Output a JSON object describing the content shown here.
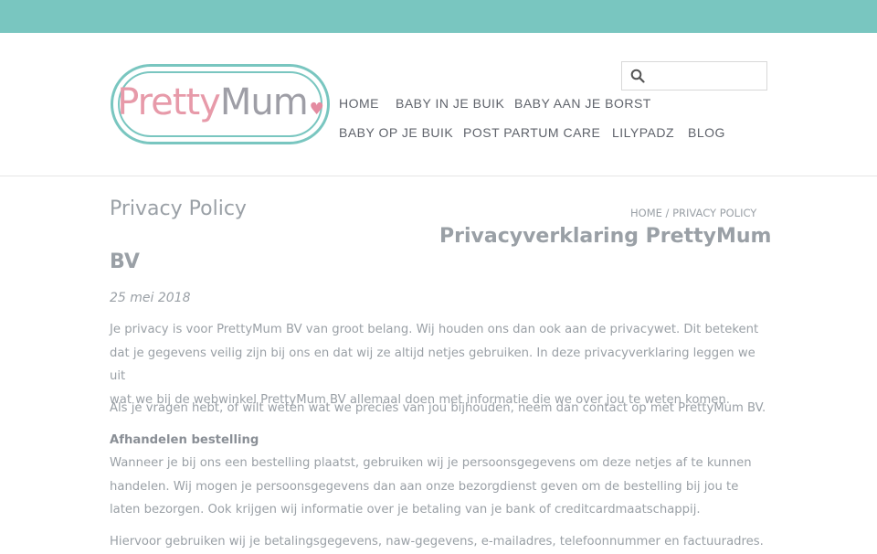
{
  "brand": {
    "part1": "Pretty",
    "part2": "Mum",
    "heart": "♥"
  },
  "search": {
    "placeholder": "",
    "icon": "search-icon"
  },
  "nav": {
    "items": [
      {
        "label": "HOME"
      },
      {
        "label": "BABY IN JE BUIK"
      },
      {
        "label": "BABY AAN JE BORST"
      },
      {
        "label": "BABY OP JE BUIK"
      },
      {
        "label": "POST PARTUM CARE"
      },
      {
        "label": "LILYPADZ"
      },
      {
        "label": "BLOG"
      }
    ]
  },
  "page": {
    "title": "Privacy Policy"
  },
  "breadcrumb": {
    "home": "HOME",
    "separator": "/",
    "current": "PRIVACY POLICY"
  },
  "content": {
    "title_line1": "Privacyverklaring PrettyMum",
    "title_line2": "BV",
    "date": "25 mei 2018",
    "intro_lines": [
      "Je privacy is voor PrettyMum BV van groot belang. Wij houden ons dan ook aan de privacywet. Dit betekent",
      "dat je gegevens veilig zijn bij ons en dat wij ze altijd netjes gebruiken. In deze privacyverklaring leggen we uit",
      "wat we bij de webwinkel PrettyMum BV allemaal doen met informatie die we over jou te weten komen."
    ],
    "contact_line": "Als je vragen hebt, of wilt weten wat we precies van jou bijhouden, neem dan contact op met PrettyMum BV.",
    "section1_heading": "Afhandelen bestelling",
    "section1_lines": [
      "Wanneer je bij ons een bestelling plaatst, gebruiken wij je persoonsgegevens om deze netjes af te kunnen",
      "handelen. Wij mogen je persoonsgegevens dan aan onze bezorgdienst geven om de bestelling bij jou te",
      "laten bezorgen. Ook krijgen wij informatie over je betaling van je bank of creditcardmaatschappij."
    ],
    "section1_followup": "Hiervoor gebruiken wij je betalingsgegevens, naw-gegevens, e-mailadres, telefoonnummer en factuuradres."
  },
  "colors": {
    "topbar": "#79c6c0",
    "logo_pink": "#e79aa9",
    "logo_gray": "#9e9ea6",
    "text": "#9aa0a6"
  }
}
